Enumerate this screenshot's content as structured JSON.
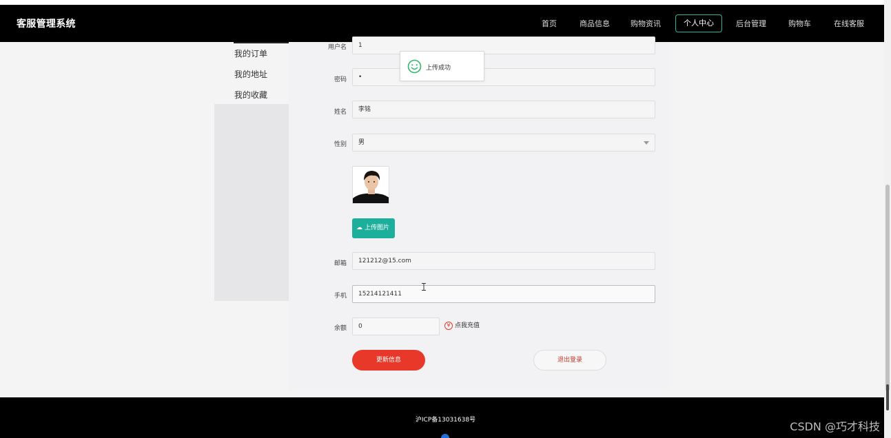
{
  "header": {
    "logo": "客服管理系统",
    "nav": [
      "首页",
      "商品信息",
      "购物资讯",
      "个人中心",
      "后台管理",
      "购物车",
      "在线客服"
    ],
    "active_nav": "个人中心"
  },
  "sidebar": {
    "items": [
      "我的订单",
      "我的地址",
      "我的收藏"
    ]
  },
  "form": {
    "username_label": "用户名",
    "username_value": "1",
    "password_label": "密码",
    "password_value": "•",
    "name_label": "姓名",
    "name_value": "李铭",
    "gender_label": "性别",
    "gender_value": "男",
    "upload_label": "上传图片",
    "email_label": "邮箱",
    "email_value": "121212@15.com",
    "phone_label": "手机",
    "phone_value": "15214121411",
    "balance_label": "余额",
    "balance_value": "0",
    "recharge_label": "点我充值",
    "recharge_icon": "¥",
    "update_button": "更新信息",
    "logout_button": "退出登录"
  },
  "toast": {
    "message": "上传成功",
    "icon": "smile-icon"
  },
  "footer": {
    "icp": "沪ICP备13031638号"
  },
  "watermark": "CSDN @巧才科技",
  "colors": {
    "accent": "#1eaf9c",
    "danger": "#e8382a",
    "header_bg": "#000000"
  }
}
